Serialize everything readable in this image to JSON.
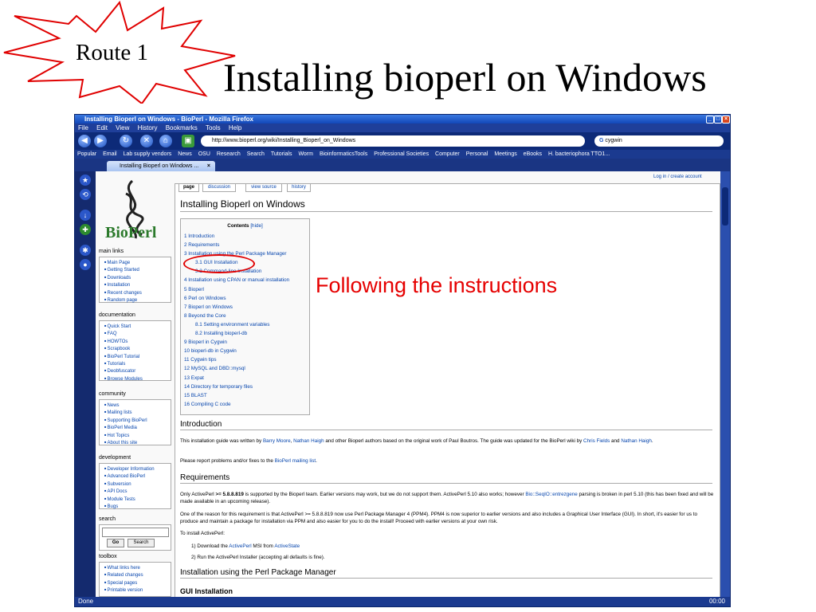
{
  "slide": {
    "tag": "Route 1",
    "title": "Installing bioperl on Windows",
    "annotation": "Following the instructions"
  },
  "browser": {
    "window_title": "Installing Bioperl on Windows - BioPerl - Mozilla Firefox",
    "menu": [
      "File",
      "Edit",
      "View",
      "History",
      "Bookmarks",
      "Tools",
      "Help"
    ],
    "url": "http://www.bioperl.org/wiki/Installing_Bioperl_on_Windows",
    "search_value": "cygwin",
    "bookmarks": [
      "Popular",
      "Email",
      "Lab supply vendors",
      "News",
      "OSU",
      "Research",
      "Search",
      "Tutorials",
      "Worm",
      "BioinformaticsTools",
      "Professional Societies",
      "Computer",
      "Personal",
      "Meetings",
      "eBooks",
      "H. bacteriophora TTO1..."
    ],
    "tab_label": "Installing Bioperl on Windows ...",
    "status": "Done",
    "clock": "00:00"
  },
  "wiki": {
    "logo_text": "BioPerl",
    "sidebar": {
      "main_links": {
        "heading": "main links",
        "items": [
          "Main Page",
          "Getting Started",
          "Downloads",
          "Installation",
          "Recent changes",
          "Random page"
        ]
      },
      "documentation": {
        "heading": "documentation",
        "items": [
          "Quick Start",
          "FAQ",
          "HOWTOs",
          "Scrapbook",
          "BioPerl Tutorial",
          "Tutorials",
          "Deobfuscator",
          "Browse Modules"
        ]
      },
      "community": {
        "heading": "community",
        "items": [
          "News",
          "Mailing lists",
          "Supporting BioPerl",
          "BioPerl Media",
          "Hot Topics",
          "About this site"
        ]
      },
      "development": {
        "heading": "development",
        "items": [
          "Developer Information",
          "Advanced BioPerl",
          "Subversion",
          "API Docs",
          "Module Tests",
          "Bugs"
        ]
      },
      "search": {
        "heading": "search",
        "go": "Go",
        "search": "Search"
      },
      "toolbox": {
        "heading": "toolbox",
        "items": [
          "What links here",
          "Related changes",
          "Special pages",
          "Printable version"
        ]
      }
    },
    "page_tabs": [
      "page",
      "discussion",
      "view source",
      "history"
    ],
    "login": "Log in / create account",
    "heading": "Installing Bioperl on Windows",
    "toc": {
      "title": "Contents",
      "hide": "[hide]",
      "items": [
        {
          "text": "1 Introduction",
          "sub": false
        },
        {
          "text": "2 Requirements",
          "sub": false
        },
        {
          "text": "3 Installation using the Perl Package Manager",
          "sub": false
        },
        {
          "text": "3.1 GUI Installation",
          "sub": true
        },
        {
          "text": "3.2 Command-line Installation",
          "sub": true
        },
        {
          "text": "4 Installation using CPAN or manual installation",
          "sub": false
        },
        {
          "text": "5 Bioperl",
          "sub": false
        },
        {
          "text": "6 Perl on Windows",
          "sub": false
        },
        {
          "text": "7 Bioperl on Windows",
          "sub": false
        },
        {
          "text": "8 Beyond the Core",
          "sub": false
        },
        {
          "text": "8.1 Setting environment variables",
          "sub": true
        },
        {
          "text": "8.2 Installing bioperl-db",
          "sub": true
        },
        {
          "text": "9 Bioperl in Cygwin",
          "sub": false
        },
        {
          "text": "10 bioperl-db in Cygwin",
          "sub": false
        },
        {
          "text": "11 Cygwin tips",
          "sub": false
        },
        {
          "text": "12 MySQL and DBD::mysql",
          "sub": false
        },
        {
          "text": "13 Expat",
          "sub": false
        },
        {
          "text": "14 Directory for temporary files",
          "sub": false
        },
        {
          "text": "15 BLAST",
          "sub": false
        },
        {
          "text": "16 Compiling C code",
          "sub": false
        }
      ]
    },
    "intro": {
      "heading": "Introduction",
      "p1_a": "This installation guide was written by ",
      "p1_link1": "Barry Moore",
      "p1_sep": ", ",
      "p1_link2": "Nathan Haigh",
      "p1_b": " and other Bioperl authors based on the original work of Paul Boutros. The guide was updated for the BioPerl wiki by ",
      "p1_link3": "Chris Fields",
      "p1_and": " and ",
      "p1_link4": "Nathan Haigh",
      "p1_end": ".",
      "p2_a": "Please report problems and/or fixes to the ",
      "p2_link": "BioPerl mailing list",
      "p2_end": "."
    },
    "requirements": {
      "heading": "Requirements",
      "p1_a": "Only ActivePerl ",
      "p1_bold": ">= 5.8.8.819",
      "p1_b": " is supported by the Bioperl team. Earlier versions may work, but we do not support them. ActivePerl 5.10 also works; however ",
      "p1_link": "Bio::SeqIO::entrezgene",
      "p1_c": " parsing is broken in perl 5.10 (this has been fixed and will be made available in an upcoming release).",
      "p2": "One of the reason for this requirement is that ActivePerl >= 5.8.8.819 now use Perl Package Manager 4 (PPM4). PPM4 is now superior to earlier versions and also includes a Graphical User Interface (GUI). In short, it's easier for us to produce and maintain a package for installation via PPM and also easier for you to do the install! Proceed with earlier versions at your own risk.",
      "p3": "To install ActivePerl:",
      "step1_a": "1) Download the ",
      "step1_link1": "ActivePerl",
      "step1_b": " MSI from ",
      "step1_link2": "ActiveState",
      "step2": "2) Run the ActivePerl Installer (accepting all defaults is fine)."
    },
    "ppm": {
      "heading": "Installation using the Perl Package Manager",
      "sub": "GUI Installation"
    }
  }
}
